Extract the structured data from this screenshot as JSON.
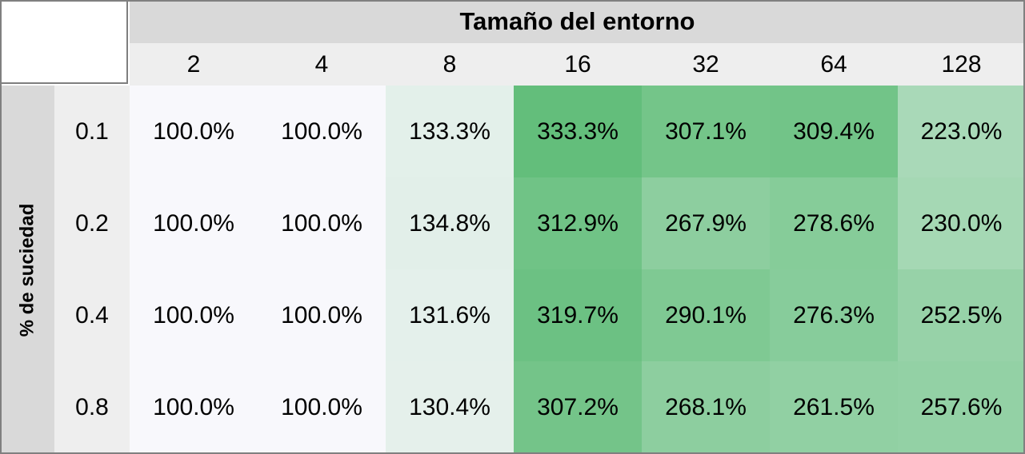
{
  "chart_data": {
    "type": "heatmap",
    "title": "",
    "xlabel": "Tamaño del entorno",
    "ylabel": "% de suciedad",
    "x_categories": [
      "2",
      "4",
      "8",
      "16",
      "32",
      "64",
      "128"
    ],
    "y_categories": [
      "0.1",
      "0.2",
      "0.4",
      "0.8"
    ],
    "values": [
      [
        100.0,
        100.0,
        133.3,
        333.3,
        307.1,
        309.4,
        223.0
      ],
      [
        100.0,
        100.0,
        134.8,
        312.9,
        267.9,
        278.6,
        230.0
      ],
      [
        100.0,
        100.0,
        131.6,
        319.7,
        290.1,
        276.3,
        252.5
      ],
      [
        100.0,
        100.0,
        130.4,
        307.2,
        268.1,
        261.5,
        257.6
      ]
    ],
    "labels": [
      [
        "100.0%",
        "100.0%",
        "133.3%",
        "333.3%",
        "307.1%",
        "309.4%",
        "223.0%"
      ],
      [
        "100.0%",
        "100.0%",
        "134.8%",
        "312.9%",
        "267.9%",
        "278.6%",
        "230.0%"
      ],
      [
        "100.0%",
        "100.0%",
        "131.6%",
        "319.7%",
        "290.1%",
        "276.3%",
        "252.5%"
      ],
      [
        "100.0%",
        "100.0%",
        "130.4%",
        "307.2%",
        "268.1%",
        "261.5%",
        "257.6%"
      ]
    ],
    "color_scale": {
      "low": "#f8f8fc",
      "high": "#63be7b"
    }
  }
}
